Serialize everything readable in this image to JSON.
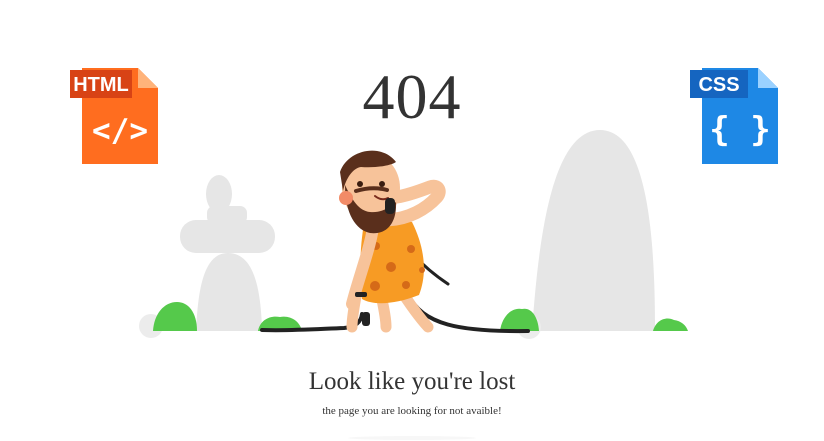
{
  "error": {
    "code": "404",
    "heading": "Look like you're lost",
    "message": "the page you are looking for not avaible!"
  },
  "file_icons": {
    "html": {
      "label": "HTML",
      "symbol": "</>",
      "icon": "html-file-icon",
      "color": "#ff6d1f"
    },
    "css": {
      "label": "CSS",
      "symbol": "{ }",
      "icon": "css-file-icon",
      "color": "#1e88e5"
    }
  },
  "illustration": {
    "description_icon": "caveman-404-illustration",
    "colors": {
      "stone": "#e7e7e7",
      "bush": "#55c94b",
      "skin": "#f7c39a",
      "hair": "#5a2f1c",
      "tunic": "#f79b24",
      "cable": "#222222"
    }
  }
}
